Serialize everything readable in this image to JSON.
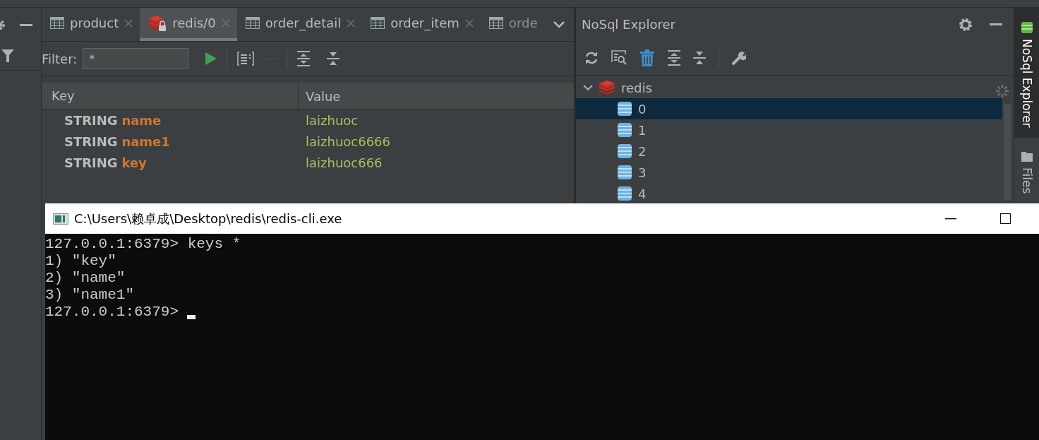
{
  "tabs": [
    {
      "label": "product",
      "kind": "table",
      "closable": true,
      "selected": false
    },
    {
      "label": "redis/0",
      "kind": "redis",
      "closable": true,
      "selected": true
    },
    {
      "label": "order_detail",
      "kind": "table",
      "closable": true,
      "selected": false
    },
    {
      "label": "order_item",
      "kind": "table",
      "closable": true,
      "selected": false
    },
    {
      "label": "orde",
      "kind": "table",
      "closable": false,
      "selected": false
    }
  ],
  "filter": {
    "label": "Filter:",
    "value": "*"
  },
  "table": {
    "columns": [
      "Key",
      "Value"
    ],
    "rows": [
      {
        "type": "STRING",
        "key": "name",
        "value": "laizhuoc"
      },
      {
        "type": "STRING",
        "key": "name1",
        "value": "laizhuoc6666"
      },
      {
        "type": "STRING",
        "key": "key",
        "value": "laizhuoc666"
      }
    ]
  },
  "explorer": {
    "title": "NoSql Explorer",
    "tree": [
      {
        "label": "redis",
        "kind": "server",
        "expanded": true,
        "selected": false,
        "children": [
          {
            "label": "0",
            "kind": "database",
            "selected": true
          },
          {
            "label": "1",
            "kind": "database",
            "selected": false
          },
          {
            "label": "2",
            "kind": "database",
            "selected": false
          },
          {
            "label": "3",
            "kind": "database",
            "selected": false
          },
          {
            "label": "4",
            "kind": "database",
            "selected": false
          }
        ]
      }
    ]
  },
  "side_tabs": [
    {
      "label": "NoSql Explorer",
      "kind": "database",
      "selected": true
    },
    {
      "label": "Files",
      "kind": "folder",
      "selected": false
    }
  ],
  "console": {
    "title": "C:\\Users\\赖卓成\\Desktop\\redis\\redis-cli.exe",
    "lines": [
      "127.0.0.1:6379> keys *",
      "1) \"key\"",
      "2) \"name\"",
      "3) \"name1\"",
      "127.0.0.1:6379>"
    ],
    "cursor": true
  }
}
